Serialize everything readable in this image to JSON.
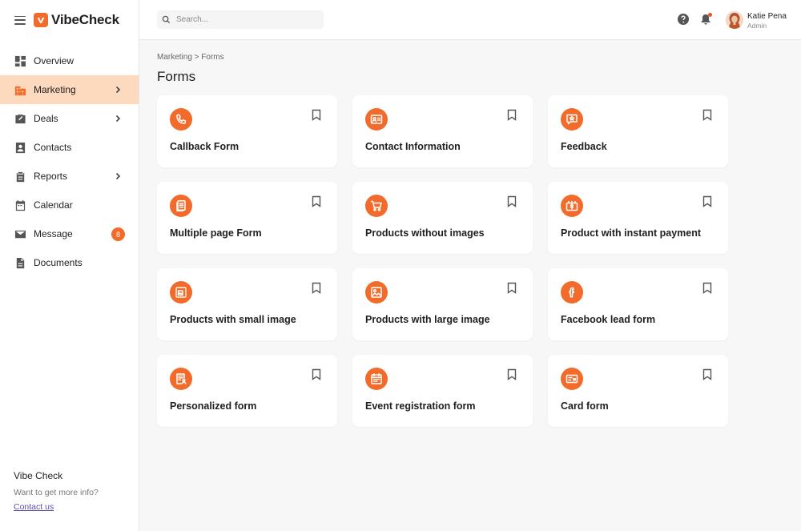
{
  "app": {
    "name": "VibeCheck"
  },
  "colors": {
    "accent": "#f26b2a",
    "active_bg": "#fdd9bd",
    "link": "#5a4ea8"
  },
  "search": {
    "placeholder": "Search..."
  },
  "user": {
    "name": "Katie Pena",
    "role": "Admin"
  },
  "sidebar": {
    "items": [
      {
        "label": "Overview",
        "icon": "dashboard-icon"
      },
      {
        "label": "Marketing",
        "icon": "building-icon",
        "active": true,
        "has_submenu": true
      },
      {
        "label": "Deals",
        "icon": "briefcase-icon",
        "has_submenu": true
      },
      {
        "label": "Contacts",
        "icon": "contact-icon"
      },
      {
        "label": "Reports",
        "icon": "clipboard-icon",
        "has_submenu": true
      },
      {
        "label": "Calendar",
        "icon": "calendar-icon"
      },
      {
        "label": "Message",
        "icon": "mail-icon",
        "badge": "8"
      },
      {
        "label": "Documents",
        "icon": "document-icon"
      }
    ],
    "footer": {
      "title": "Vibe Check",
      "subtitle": "Want to get more info?",
      "link": "Contact us"
    }
  },
  "breadcrumb": {
    "text": "Marketing > Forms"
  },
  "page": {
    "title": "Forms"
  },
  "forms": [
    {
      "label": "Callback Form",
      "icon": "phone-icon"
    },
    {
      "label": "Contact Information",
      "icon": "id-card-icon"
    },
    {
      "label": "Feedback",
      "icon": "feedback-icon"
    },
    {
      "label": "Multiple page Form",
      "icon": "pages-icon"
    },
    {
      "label": "Products without images",
      "icon": "cart-icon"
    },
    {
      "label": "Product with instant payment",
      "icon": "payment-icon"
    },
    {
      "label": "Products with small image",
      "icon": "small-image-icon"
    },
    {
      "label": "Products with large image",
      "icon": "image-icon"
    },
    {
      "label": "Facebook lead form",
      "icon": "facebook-icon"
    },
    {
      "label": "Personalized form",
      "icon": "personalized-form-icon"
    },
    {
      "label": "Event registration form",
      "icon": "event-icon"
    },
    {
      "label": "Card form",
      "icon": "card-icon"
    }
  ]
}
